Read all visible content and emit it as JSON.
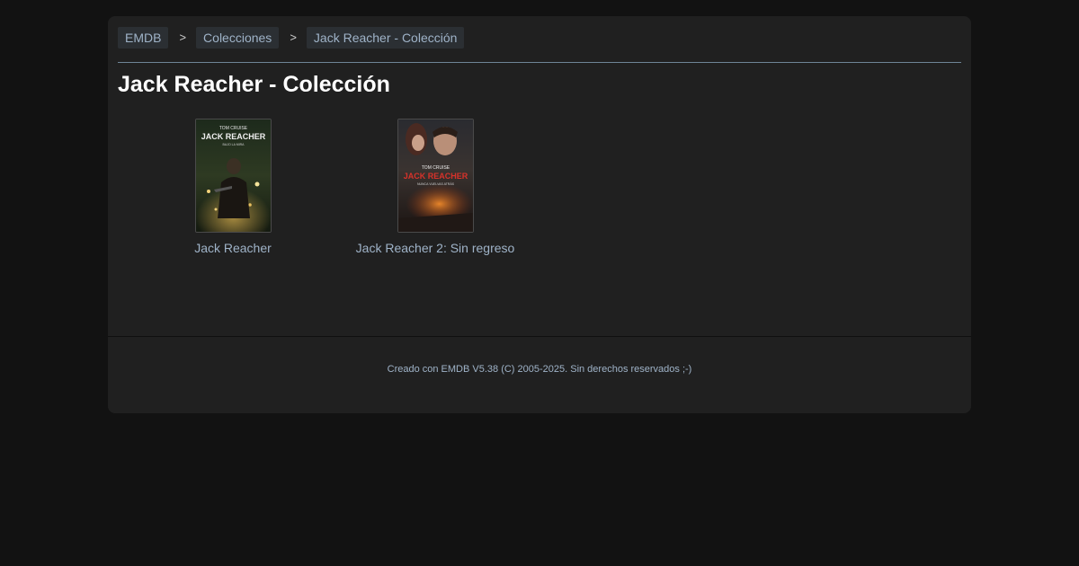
{
  "breadcrumb": {
    "items": [
      "EMDB",
      "Colecciones",
      "Jack Reacher - Colección"
    ],
    "separator": ">"
  },
  "page": {
    "title": "Jack Reacher - Colección"
  },
  "movies": [
    {
      "title": "Jack Reacher",
      "poster_text": {
        "actor": "TOM CRUISE",
        "name": "JACK REACHER",
        "tagline": "BAJO LA MIRA"
      }
    },
    {
      "title": "Jack Reacher 2: Sin regreso",
      "poster_text": {
        "actor": "TOM CRUISE",
        "name": "JACK REACHER",
        "tagline": "NUNCA VUELVAS ATRÁS"
      }
    }
  ],
  "footer": {
    "text": "Creado con EMDB V5.38 (C) 2005-2025. Sin derechos reservados ;-)"
  },
  "colors": {
    "background": "#121212",
    "panel": "#202020",
    "link": "#9fb3c8",
    "divider": "#6e8597",
    "title": "#ffffff"
  }
}
